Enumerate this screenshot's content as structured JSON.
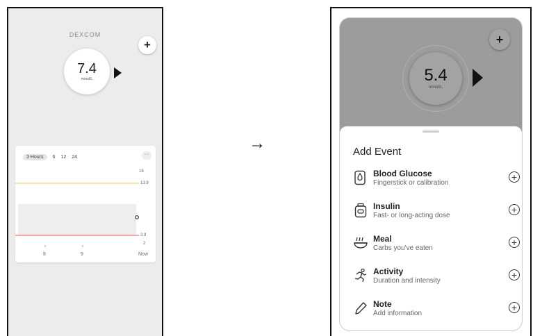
{
  "left_screen": {
    "brand": "DEXCOM",
    "add_button": "+",
    "glucose": {
      "value": "7.4",
      "unit": "mmol/L"
    },
    "graph": {
      "ranges": [
        "3 Hours",
        "6",
        "12",
        "24"
      ],
      "active_range": "3 Hours",
      "more": "···",
      "y_labels": [
        "16",
        "13.9",
        "3.9",
        "2"
      ],
      "x_labels": [
        "8",
        "9",
        "Now"
      ],
      "high_line": 13.9,
      "low_line": 3.9,
      "colors": {
        "high": "#f2c94c",
        "low": "#eb5757",
        "range_band": "#eeeeee"
      }
    }
  },
  "arrow": "→",
  "right_screen": {
    "add_button": "+",
    "glucose": {
      "value": "5.4",
      "unit": "mmol/L"
    },
    "sheet": {
      "title": "Add Event",
      "events": [
        {
          "title": "Blood Glucose",
          "subtitle": "Fingerstick or calibration",
          "icon": "blood-drop-meter-icon"
        },
        {
          "title": "Insulin",
          "subtitle": "Fast- or long-acting dose",
          "icon": "insulin-pen-icon"
        },
        {
          "title": "Meal",
          "subtitle": "Carbs you've eaten",
          "icon": "meal-bowl-icon"
        },
        {
          "title": "Activity",
          "subtitle": "Duration and intensity",
          "icon": "running-person-icon"
        },
        {
          "title": "Note",
          "subtitle": "Add information",
          "icon": "pencil-icon"
        }
      ]
    }
  }
}
